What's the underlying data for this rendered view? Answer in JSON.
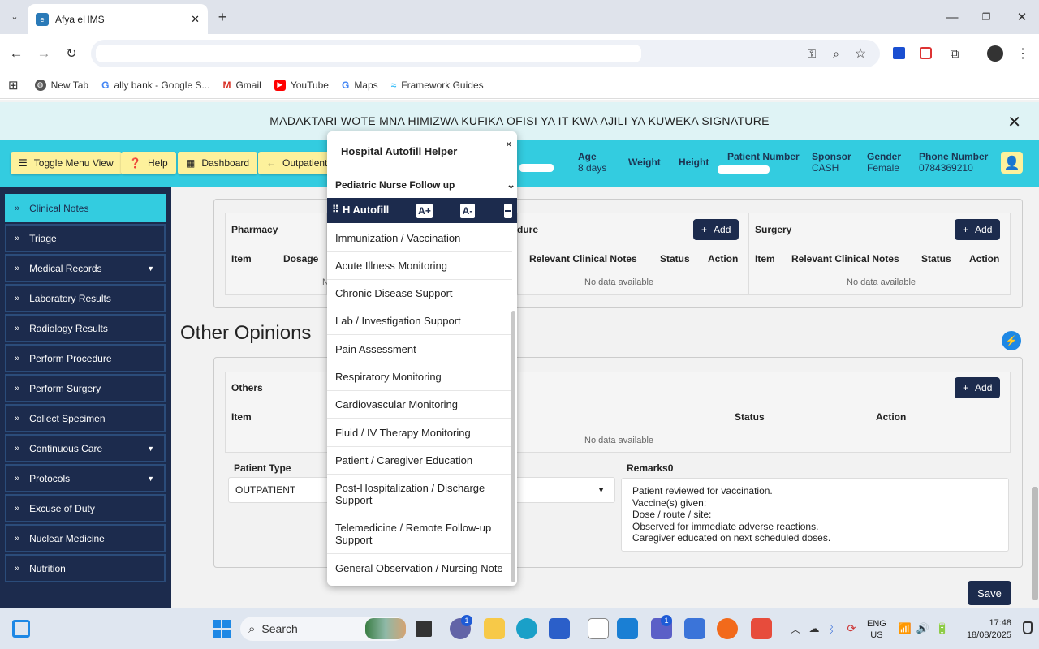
{
  "browser": {
    "tab_title": "Afya eHMS",
    "favicon_text": "e",
    "bookmarks": [
      "New Tab",
      "ally bank - Google S...",
      "Gmail",
      "YouTube",
      "Maps",
      "Framework Guides"
    ]
  },
  "banner": {
    "text": "MADAKTARI WOTE MNA HIMIZWA KUFIKA OFISI YA IT KWA AJILI YA KUWEKA SIGNATURE"
  },
  "header": {
    "buttons": [
      "Toggle Menu View",
      "Help",
      "Dashboard",
      "Outpatient"
    ],
    "fields": [
      {
        "label": "Age",
        "value": "8 days"
      },
      {
        "label": "Weight",
        "value": ""
      },
      {
        "label": "Height",
        "value": ""
      },
      {
        "label": "Patient Number",
        "value": ""
      },
      {
        "label": "Sponsor",
        "value": "CASH"
      },
      {
        "label": "Gender",
        "value": "Female"
      },
      {
        "label": "Phone Number",
        "value": "0784369210"
      }
    ]
  },
  "sidebar": {
    "items": [
      {
        "label": "Clinical Notes",
        "active": true
      },
      {
        "label": "Triage"
      },
      {
        "label": "Medical Records",
        "dropdown": true
      },
      {
        "label": "Laboratory Results"
      },
      {
        "label": "Radiology Results"
      },
      {
        "label": "Perform Procedure"
      },
      {
        "label": "Perform Surgery"
      },
      {
        "label": "Collect Specimen"
      },
      {
        "label": "Continuous Care",
        "dropdown": true
      },
      {
        "label": "Protocols",
        "dropdown": true
      },
      {
        "label": "Excuse of Duty"
      },
      {
        "label": "Nuclear Medicine"
      },
      {
        "label": "Nutrition"
      }
    ]
  },
  "orders": {
    "pharmacy": {
      "title": "Pharmacy",
      "cols": [
        "Item",
        "Dosage"
      ],
      "empty": "N"
    },
    "procedure": {
      "title": "dure",
      "add": "Add",
      "cols": [
        "Relevant Clinical Notes",
        "Status",
        "Action"
      ],
      "empty": "No data available"
    },
    "surgery": {
      "title": "Surgery",
      "add": "Add",
      "cols": [
        "Item",
        "Relevant Clinical Notes",
        "Status",
        "Action"
      ],
      "empty": "No data available"
    }
  },
  "other_opinions": {
    "heading": "Other Opinions",
    "others_title": "Others",
    "add": "Add",
    "cols": [
      "Item",
      "Status",
      "Action"
    ],
    "empty": "No data available",
    "patient_type_label": "Patient Type",
    "patient_type_value": "OUTPATIENT",
    "remarks_label": "Remarks0",
    "remarks": "Patient reviewed for vaccination.\nVaccine(s) given:\nDose / route / site:\nObserved for immediate adverse reactions.\nCaregiver educated on next scheduled doses."
  },
  "save_label": "Save",
  "popup": {
    "title": "Hospital Autofill Helper",
    "close": "×",
    "selected": "Pediatric Nurse Follow up",
    "bar_title": "H Autofill",
    "font_up": "A+",
    "font_down": "A-",
    "options": [
      "Immunization / Vaccination",
      "Acute Illness Monitoring",
      "Chronic Disease Support",
      "Lab / Investigation Support",
      "Pain Assessment",
      "Respiratory Monitoring",
      "Cardiovascular Monitoring",
      "Fluid / IV Therapy Monitoring",
      "Patient / Caregiver Education",
      "Post-Hospitalization / Discharge Support",
      "Telemedicine / Remote Follow-up Support",
      "General Observation / Nursing Note"
    ]
  },
  "taskbar": {
    "search": "Search",
    "lang1": "ENG",
    "lang2": "US",
    "time": "17:48",
    "date": "18/08/2025",
    "badge_chat": "1",
    "badge_teams": "1"
  }
}
